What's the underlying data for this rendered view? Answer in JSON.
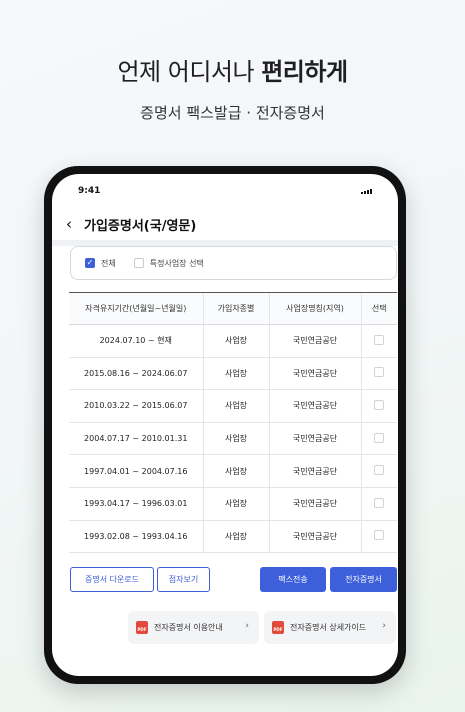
{
  "headline": {
    "regular": "언제 어디서나 ",
    "bold": "편리하게"
  },
  "subheadline": "증명서 팩스발급 · 전자증명서",
  "status_bar": {
    "time": "9:41"
  },
  "header": {
    "back_icon": "chevron-left-icon",
    "title": "가입증명서(국/영문)"
  },
  "filter": {
    "all_label": "전체",
    "all_checked": true,
    "specific_label": "특정사업장 선택",
    "specific_checked": false
  },
  "table": {
    "columns": [
      "자격유지기간(년월일~년월일)",
      "가입자종별",
      "사업장명칭(지역)",
      "선택"
    ],
    "rows": [
      {
        "period": "2024.07.10 ~ 현재",
        "type": "사업장",
        "name": "국민연금공단",
        "selected": false
      },
      {
        "period": "2015.08.16 ~ 2024.06.07",
        "type": "사업장",
        "name": "국민연금공단",
        "selected": false
      },
      {
        "period": "2010.03.22 ~ 2015.06.07",
        "type": "사업장",
        "name": "국민연금공단",
        "selected": false
      },
      {
        "period": "2004.07.17 ~ 2010.01.31",
        "type": "사업장",
        "name": "국민연금공단",
        "selected": false
      },
      {
        "period": "1997.04.01 ~ 2004.07.16",
        "type": "사업장",
        "name": "국민연금공단",
        "selected": false
      },
      {
        "period": "1993.04.17 ~ 1996.03.01",
        "type": "사업장",
        "name": "국민연금공단",
        "selected": false
      },
      {
        "period": "1993.02.08 ~ 1993.04.16",
        "type": "사업장",
        "name": "국민연금공단",
        "selected": false
      }
    ]
  },
  "actions": {
    "download": "증명서 다운로드",
    "preview": "점자보기",
    "fax": "팩스전송",
    "e_cert": "전자증명서"
  },
  "guides": {
    "usage": "전자증명서 이용안내",
    "detail": "전자증명서 상세가이드",
    "pdf_badge": "PDF"
  },
  "colors": {
    "accent": "#3d5fd9",
    "pdf": "#e24a3b"
  }
}
